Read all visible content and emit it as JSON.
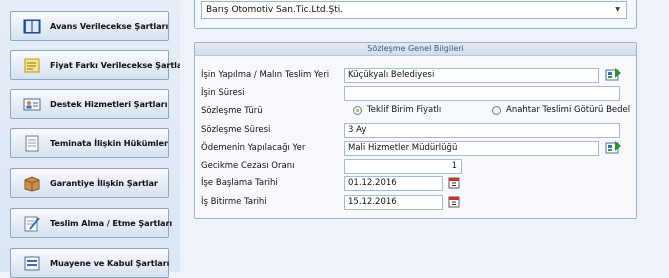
{
  "sidebar": {
    "items": [
      {
        "label": "Avans Verilecekse Şartları",
        "icon": "book-icon"
      },
      {
        "label": "Fiyat Farkı Verilecekse Şartları",
        "icon": "sticky-note-icon"
      },
      {
        "label": "Destek Hizmetleri Şartları",
        "icon": "contact-card-icon"
      },
      {
        "label": "Teminata İlişkin Hükümler",
        "icon": "document-icon"
      },
      {
        "label": "Garantiye İlişkin Şartlar",
        "icon": "box-icon"
      },
      {
        "label": "Teslim Alma / Etme Şartları",
        "icon": "edit-document-icon"
      },
      {
        "label": "Muayene ve Kabul Şartları",
        "icon": "list-document-icon"
      }
    ]
  },
  "company": {
    "selected": "Barış Otomotiv San.Tic.Ltd.Şti."
  },
  "contract": {
    "header": "Sözleşme Genel Bilgileri",
    "labels": {
      "work_place": "İşin Yapılma / Malın Teslim Yeri",
      "duration": "İşin Süresi",
      "type": "Sözleşme Türü",
      "contract_duration": "Sözleşme Süresi",
      "payment_place": "Ödemenin Yapılacağı Yer",
      "penalty_rate": "Gecikme Cezası Oranı",
      "start_date": "İşe Başlama Tarihi",
      "end_date": "İş Bitirme Tarihi"
    },
    "values": {
      "work_place": "Küçükyalı Belediyesi",
      "duration": "",
      "contract_duration": "3 Ay",
      "payment_place": "Mali Hizmetler Müdürlüğü",
      "penalty_rate": "1",
      "start_date": "01.12.2016",
      "end_date": "15.12.2016"
    },
    "type_options": {
      "unit_price": "Teklif Birim Fiyatlı",
      "lump_sum": "Anahtar Teslimi Götürü Bedel"
    },
    "selected_type": "unit_price"
  },
  "colors": {
    "accent": "#3b5a86",
    "border": "#9db3cd",
    "radio_selected": "#e1a22a"
  }
}
